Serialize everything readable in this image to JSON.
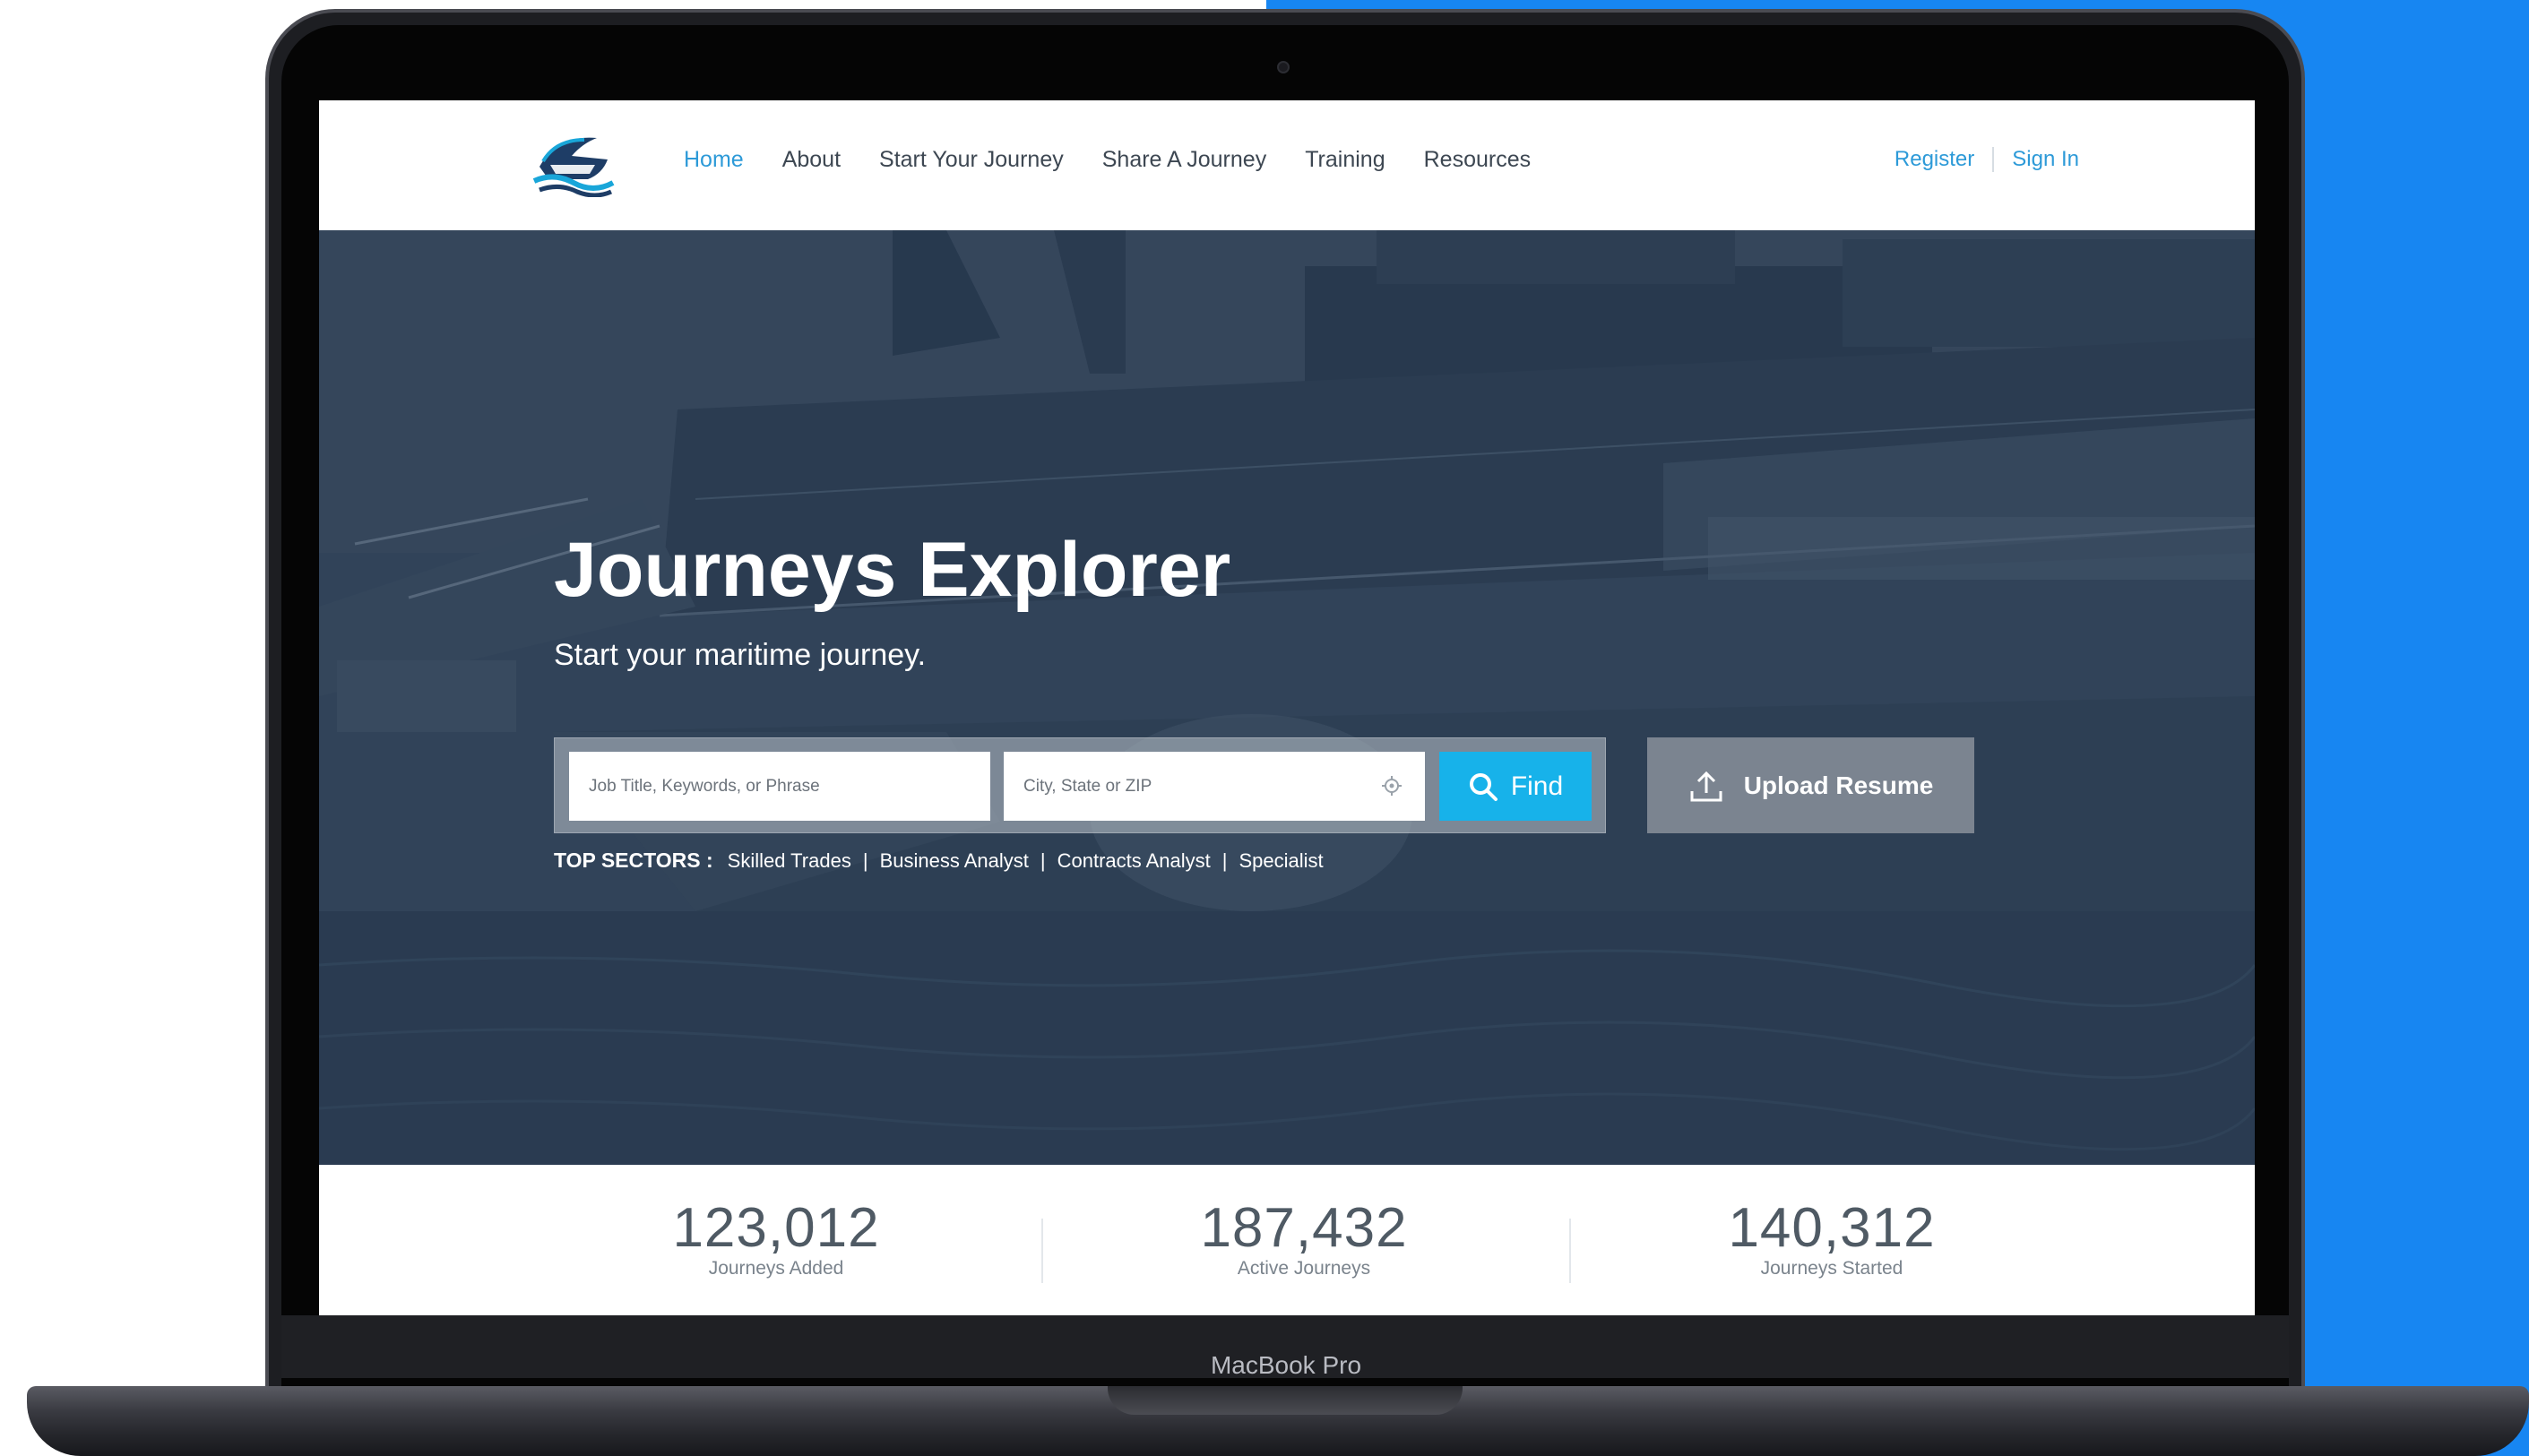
{
  "device": {
    "label": "MacBook Pro"
  },
  "nav": {
    "items": [
      {
        "label": "Home",
        "active": true
      },
      {
        "label": "About"
      },
      {
        "label": "Start Your Journey"
      },
      {
        "label": "Share A Journey"
      },
      {
        "label": "Training"
      },
      {
        "label": "Resources"
      }
    ],
    "register": "Register",
    "sign_in": "Sign In"
  },
  "hero": {
    "title": "Journeys Explorer",
    "subtitle": "Start your maritime journey."
  },
  "search": {
    "keyword_placeholder": "Job Title, Keywords, or Phrase",
    "location_placeholder": "City, State or ZIP",
    "find_label": "Find",
    "upload_label": "Upload Resume"
  },
  "sectors": {
    "label": "TOP SECTORS :",
    "items": [
      "Skilled Trades",
      "Business Analyst",
      "Contracts Analyst",
      "Specialist"
    ]
  },
  "stats": [
    {
      "value": "123,012",
      "label": "Journeys Added"
    },
    {
      "value": "187,432",
      "label": "Active Journeys"
    },
    {
      "value": "140,312",
      "label": "Journeys Started"
    }
  ],
  "colors": {
    "accent": "#2d9ad8",
    "find_button": "#17b2ea",
    "background_blue": "#1786f2",
    "hero_overlay": "#34445a"
  },
  "icons": {
    "logo": "ship-logo",
    "location": "location-target-icon",
    "find": "search-icon",
    "upload": "upload-icon"
  }
}
